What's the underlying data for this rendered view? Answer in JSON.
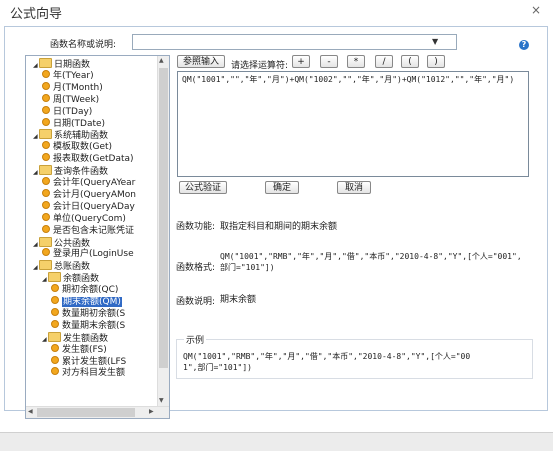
{
  "window": {
    "title": "公式向导",
    "close_glyph": "×"
  },
  "search": {
    "label": "函数名称或说明:",
    "value": "",
    "dropdown_glyph": "▼"
  },
  "help_glyph": "?",
  "tree": {
    "items": [
      {
        "label": "日期函数",
        "level": 0,
        "type": "folder",
        "expanded": true
      },
      {
        "label": "年(TYear)",
        "level": 1,
        "type": "leaf"
      },
      {
        "label": "月(TMonth)",
        "level": 1,
        "type": "leaf"
      },
      {
        "label": "周(TWeek)",
        "level": 1,
        "type": "leaf"
      },
      {
        "label": "日(TDay)",
        "level": 1,
        "type": "leaf"
      },
      {
        "label": "日期(TDate)",
        "level": 1,
        "type": "leaf"
      },
      {
        "label": "系统辅助函数",
        "level": 0,
        "type": "folder",
        "expanded": true
      },
      {
        "label": "模板取数(Get)",
        "level": 1,
        "type": "leaf"
      },
      {
        "label": "报表取数(GetData)",
        "level": 1,
        "type": "leaf"
      },
      {
        "label": "查询条件函数",
        "level": 0,
        "type": "folder",
        "expanded": true
      },
      {
        "label": "会计年(QueryAYear",
        "level": 1,
        "type": "leaf"
      },
      {
        "label": "会计月(QueryAMon",
        "level": 1,
        "type": "leaf"
      },
      {
        "label": "会计日(QueryADay",
        "level": 1,
        "type": "leaf"
      },
      {
        "label": "单位(QueryCom)",
        "level": 1,
        "type": "leaf"
      },
      {
        "label": "是否包含未记账凭证",
        "level": 1,
        "type": "leaf"
      },
      {
        "label": "公共函数",
        "level": 0,
        "type": "folder",
        "expanded": true
      },
      {
        "label": "登录用户(LoginUse",
        "level": 1,
        "type": "leaf"
      },
      {
        "label": "总账函数",
        "level": 0,
        "type": "folder",
        "expanded": true
      },
      {
        "label": "余额函数",
        "level": 1,
        "type": "folder",
        "expanded": true
      },
      {
        "label": "期初余额(QC)",
        "level": 2,
        "type": "leaf"
      },
      {
        "label": "期末余额(QM)",
        "level": 2,
        "type": "leaf",
        "selected": true
      },
      {
        "label": "数量期初余额(S",
        "level": 2,
        "type": "leaf"
      },
      {
        "label": "数量期末余额(S",
        "level": 2,
        "type": "leaf"
      },
      {
        "label": "发生额函数",
        "level": 1,
        "type": "folder",
        "expanded": true
      },
      {
        "label": "发生额(FS)",
        "level": 2,
        "type": "leaf"
      },
      {
        "label": "累计发生额(LFS",
        "level": 2,
        "type": "leaf"
      },
      {
        "label": "对方科目发生额",
        "level": 2,
        "type": "leaf"
      }
    ]
  },
  "toolbar": {
    "reference_input": "参照输入",
    "operator_label": "请选择运算符:",
    "operators": [
      "+",
      "-",
      "*",
      "/",
      "(",
      ")"
    ]
  },
  "editor": {
    "value": "QM(\"1001\",\"\",\"年\",\"月\")+QM(\"1002\",\"\",\"年\",\"月\")+QM(\"1012\",\"\",\"年\",\"月\")"
  },
  "actions": {
    "verify": "公式验证",
    "ok": "确定",
    "cancel": "取消"
  },
  "info": {
    "function_label": "函数功能:",
    "function_value": "取指定科目和期间的期末余额",
    "format_label": "函数格式:",
    "format_value": "QM(\"1001\",\"RMB\",\"年\",\"月\",\"借\",\"本币\",\"2010-4-8\",\"Y\",[个人=\"001\",部门=\"101\"])",
    "desc_label": "函数说明:",
    "desc_value": "期末余额"
  },
  "example": {
    "legend": "示例",
    "value": "QM(\"1001\",\"RMB\",\"年\",\"月\",\"借\",\"本币\",\"2010-4-8\",\"Y\",[个人=\"001\",部门=\"101\"])"
  },
  "scroll_glyphs": {
    "up": "▲",
    "down": "▼",
    "left": "◀",
    "right": "▶"
  },
  "colors": {
    "selection": "#316ac5",
    "help": "#2a74c9"
  }
}
